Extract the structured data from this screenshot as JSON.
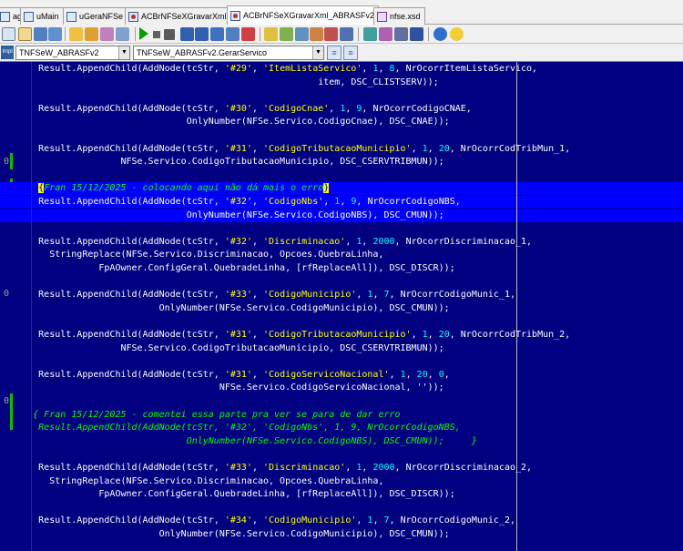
{
  "tabs": [
    {
      "label": "age",
      "icon": "unit-file-icon",
      "active": false
    },
    {
      "label": "uMain",
      "icon": "unit-file-icon",
      "active": false
    },
    {
      "label": "uGeraNFSe",
      "icon": "unit-file-icon",
      "active": false
    },
    {
      "label": "ACBrNFSeXGravarXml",
      "icon": "pascal-file-icon",
      "active": false
    },
    {
      "label": "ACBrNFSeXGravarXml_ABRASFv2",
      "icon": "pascal-file-icon",
      "active": true
    },
    {
      "label": "nfse.xsd",
      "icon": "xml-file-icon",
      "active": false
    }
  ],
  "navigator": {
    "class_combo": "TNFSeW_ABRASFv2",
    "method_combo": "TNFSeW_ABRASFv2.GerarServico",
    "icon_label": "Impl"
  },
  "gutter": [
    "0",
    "2",
    "0",
    "0"
  ],
  "code": [
    [
      {
        "t": "  Result.AppendChild(AddNode(tcStr, "
      },
      {
        "t": "'#29'",
        "k": "s"
      },
      {
        "t": ", "
      },
      {
        "t": "'ItemListaServico'",
        "k": "s"
      },
      {
        "t": ", "
      },
      {
        "t": "1",
        "k": "n"
      },
      {
        "t": ", "
      },
      {
        "t": "8",
        "k": "n"
      },
      {
        "t": ", NrOcorrItemListaServico,"
      }
    ],
    [
      {
        "t": "                                                     item, DSC_CLISTSERV));"
      }
    ],
    [],
    [
      {
        "t": "  Result.AppendChild(AddNode(tcStr, "
      },
      {
        "t": "'#30'",
        "k": "s"
      },
      {
        "t": ", "
      },
      {
        "t": "'CodigoCnae'",
        "k": "s"
      },
      {
        "t": ", "
      },
      {
        "t": "1",
        "k": "n"
      },
      {
        "t": ", "
      },
      {
        "t": "9",
        "k": "n"
      },
      {
        "t": ", NrOcorrCodigoCNAE,"
      }
    ],
    [
      {
        "t": "                             OnlyNumber(NFSe.Servico.CodigoCnae), DSC_CNAE));"
      }
    ],
    [],
    [
      {
        "t": "  Result.AppendChild(AddNode(tcStr, "
      },
      {
        "t": "'#31'",
        "k": "s"
      },
      {
        "t": ", "
      },
      {
        "t": "'CodigoTributacaoMunicipio'",
        "k": "s"
      },
      {
        "t": ", "
      },
      {
        "t": "1",
        "k": "n"
      },
      {
        "t": ", "
      },
      {
        "t": "20",
        "k": "n"
      },
      {
        "t": ", NrOcorrCodTribMun_1,"
      }
    ],
    [
      {
        "t": "                 NFSe.Servico.CodigoTributacaoMunicipio, DSC_CSERVTRIBMUN));"
      }
    ],
    [],
    [
      {
        "t": "  "
      },
      {
        "t": "{",
        "k": "bc"
      },
      {
        "t": "Fran 15/12/2025 - colocando aqui não dá mais o erro",
        "k": "c"
      },
      {
        "t": "}",
        "k": "bc"
      }
    ],
    [
      {
        "t": "  Result.AppendChild(AddNode(tcStr, "
      },
      {
        "t": "'#32'",
        "k": "s"
      },
      {
        "t": ", "
      },
      {
        "t": "'CodigoNbs'",
        "k": "s"
      },
      {
        "t": ", "
      },
      {
        "t": "1",
        "k": "n"
      },
      {
        "t": ", "
      },
      {
        "t": "9",
        "k": "n"
      },
      {
        "t": ", NrOcorrCodigoNBS,"
      }
    ],
    [
      {
        "t": "                             OnlyNumber(NFSe.Servico.CodigoNBS), DSC_CMUN));"
      }
    ],
    [],
    [
      {
        "t": "  Result.AppendChild(AddNode(tcStr, "
      },
      {
        "t": "'#32'",
        "k": "s"
      },
      {
        "t": ", "
      },
      {
        "t": "'Discriminacao'",
        "k": "s"
      },
      {
        "t": ", "
      },
      {
        "t": "1",
        "k": "n"
      },
      {
        "t": ", "
      },
      {
        "t": "2000",
        "k": "n"
      },
      {
        "t": ", NrOcorrDiscriminacao_1,"
      }
    ],
    [
      {
        "t": "    StringReplace(NFSe.Servico.Discriminacao, Opcoes.QuebraLinha,"
      }
    ],
    [
      {
        "t": "             FpAOwner.ConfigGeral.QuebradeLinha, [rfReplaceAll]), DSC_DISCR));"
      }
    ],
    [],
    [
      {
        "t": "  Result.AppendChild(AddNode(tcStr, "
      },
      {
        "t": "'#33'",
        "k": "s"
      },
      {
        "t": ", "
      },
      {
        "t": "'CodigoMunicipio'",
        "k": "s"
      },
      {
        "t": ", "
      },
      {
        "t": "1",
        "k": "n"
      },
      {
        "t": ", "
      },
      {
        "t": "7",
        "k": "n"
      },
      {
        "t": ", NrOcorrCodigoMunic_1,"
      }
    ],
    [
      {
        "t": "                        OnlyNumber(NFSe.Servico.CodigoMunicipio), DSC_CMUN));"
      }
    ],
    [],
    [
      {
        "t": "  Result.AppendChild(AddNode(tcStr, "
      },
      {
        "t": "'#31'",
        "k": "s"
      },
      {
        "t": ", "
      },
      {
        "t": "'CodigoTributacaoMunicipio'",
        "k": "s"
      },
      {
        "t": ", "
      },
      {
        "t": "1",
        "k": "n"
      },
      {
        "t": ", "
      },
      {
        "t": "20",
        "k": "n"
      },
      {
        "t": ", NrOcorrCodTribMun_2,"
      }
    ],
    [
      {
        "t": "                 NFSe.Servico.CodigoTributacaoMunicipio, DSC_CSERVTRIBMUN));"
      }
    ],
    [],
    [
      {
        "t": "  Result.AppendChild(AddNode(tcStr, "
      },
      {
        "t": "'#31'",
        "k": "s"
      },
      {
        "t": ", "
      },
      {
        "t": "'CodigoServicoNacional'",
        "k": "s"
      },
      {
        "t": ", "
      },
      {
        "t": "1",
        "k": "n"
      },
      {
        "t": ", "
      },
      {
        "t": "20",
        "k": "n"
      },
      {
        "t": ", "
      },
      {
        "t": "0",
        "k": "n"
      },
      {
        "t": ","
      }
    ],
    [
      {
        "t": "                                   NFSe.Servico.CodigoServicoNacional, ''));"
      }
    ],
    [],
    [
      {
        "t": " { Fran 15/12/2025 - comentei essa parte pra ver se para de dar erro",
        "k": "c"
      }
    ],
    [
      {
        "t": "  Result.AppendChild(AddNode(tcStr, '#32', 'CodigoNbs', 1, 9, NrOcorrCodigoNBS,",
        "k": "c"
      }
    ],
    [
      {
        "t": "                             OnlyNumber(NFSe.Servico.CodigoNBS), DSC_CMUN));     }",
        "k": "c"
      }
    ],
    [],
    [
      {
        "t": "  Result.AppendChild(AddNode(tcStr, "
      },
      {
        "t": "'#33'",
        "k": "s"
      },
      {
        "t": ", "
      },
      {
        "t": "'Discriminacao'",
        "k": "s"
      },
      {
        "t": ", "
      },
      {
        "t": "1",
        "k": "n"
      },
      {
        "t": ", "
      },
      {
        "t": "2000",
        "k": "n"
      },
      {
        "t": ", NrOcorrDiscriminacao_2,"
      }
    ],
    [
      {
        "t": "    StringReplace(NFSe.Servico.Discriminacao, Opcoes.QuebraLinha,"
      }
    ],
    [
      {
        "t": "             FpAOwner.ConfigGeral.QuebradeLinha, [rfReplaceAll]), DSC_DISCR));"
      }
    ],
    [],
    [
      {
        "t": "  Result.AppendChild(AddNode(tcStr, "
      },
      {
        "t": "'#34'",
        "k": "s"
      },
      {
        "t": ", "
      },
      {
        "t": "'CodigoMunicipio'",
        "k": "s"
      },
      {
        "t": ", "
      },
      {
        "t": "1",
        "k": "n"
      },
      {
        "t": ", "
      },
      {
        "t": "7",
        "k": "n"
      },
      {
        "t": ", NrOcorrCodigoMunic_2,"
      }
    ],
    [
      {
        "t": "                        OnlyNumber(NFSe.Servico.CodigoMunicipio), DSC_CMUN));"
      }
    ]
  ],
  "selection_lines": [
    9,
    10,
    11
  ],
  "colors": {
    "editor_bg": "#000080",
    "selection": "#0000ff",
    "string": "#ffff00",
    "number": "#00ffff",
    "comment": "#00ff00",
    "text": "#ffffff"
  }
}
